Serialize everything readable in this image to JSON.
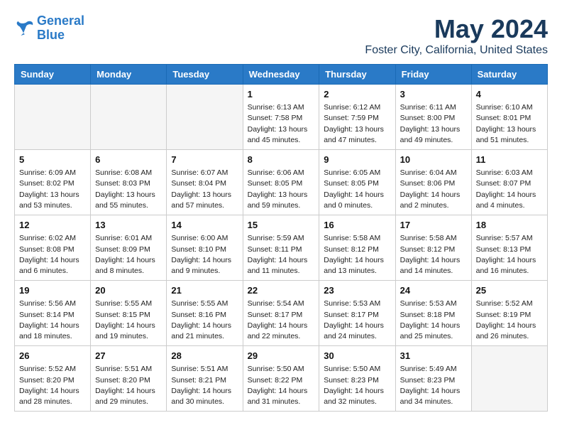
{
  "header": {
    "logo_line1": "General",
    "logo_line2": "Blue",
    "month": "May 2024",
    "location": "Foster City, California, United States"
  },
  "weekdays": [
    "Sunday",
    "Monday",
    "Tuesday",
    "Wednesday",
    "Thursday",
    "Friday",
    "Saturday"
  ],
  "weeks": [
    [
      {
        "day": "",
        "sunrise": "",
        "sunset": "",
        "daylight": ""
      },
      {
        "day": "",
        "sunrise": "",
        "sunset": "",
        "daylight": ""
      },
      {
        "day": "",
        "sunrise": "",
        "sunset": "",
        "daylight": ""
      },
      {
        "day": "1",
        "sunrise": "Sunrise: 6:13 AM",
        "sunset": "Sunset: 7:58 PM",
        "daylight": "Daylight: 13 hours and 45 minutes."
      },
      {
        "day": "2",
        "sunrise": "Sunrise: 6:12 AM",
        "sunset": "Sunset: 7:59 PM",
        "daylight": "Daylight: 13 hours and 47 minutes."
      },
      {
        "day": "3",
        "sunrise": "Sunrise: 6:11 AM",
        "sunset": "Sunset: 8:00 PM",
        "daylight": "Daylight: 13 hours and 49 minutes."
      },
      {
        "day": "4",
        "sunrise": "Sunrise: 6:10 AM",
        "sunset": "Sunset: 8:01 PM",
        "daylight": "Daylight: 13 hours and 51 minutes."
      }
    ],
    [
      {
        "day": "5",
        "sunrise": "Sunrise: 6:09 AM",
        "sunset": "Sunset: 8:02 PM",
        "daylight": "Daylight: 13 hours and 53 minutes."
      },
      {
        "day": "6",
        "sunrise": "Sunrise: 6:08 AM",
        "sunset": "Sunset: 8:03 PM",
        "daylight": "Daylight: 13 hours and 55 minutes."
      },
      {
        "day": "7",
        "sunrise": "Sunrise: 6:07 AM",
        "sunset": "Sunset: 8:04 PM",
        "daylight": "Daylight: 13 hours and 57 minutes."
      },
      {
        "day": "8",
        "sunrise": "Sunrise: 6:06 AM",
        "sunset": "Sunset: 8:05 PM",
        "daylight": "Daylight: 13 hours and 59 minutes."
      },
      {
        "day": "9",
        "sunrise": "Sunrise: 6:05 AM",
        "sunset": "Sunset: 8:05 PM",
        "daylight": "Daylight: 14 hours and 0 minutes."
      },
      {
        "day": "10",
        "sunrise": "Sunrise: 6:04 AM",
        "sunset": "Sunset: 8:06 PM",
        "daylight": "Daylight: 14 hours and 2 minutes."
      },
      {
        "day": "11",
        "sunrise": "Sunrise: 6:03 AM",
        "sunset": "Sunset: 8:07 PM",
        "daylight": "Daylight: 14 hours and 4 minutes."
      }
    ],
    [
      {
        "day": "12",
        "sunrise": "Sunrise: 6:02 AM",
        "sunset": "Sunset: 8:08 PM",
        "daylight": "Daylight: 14 hours and 6 minutes."
      },
      {
        "day": "13",
        "sunrise": "Sunrise: 6:01 AM",
        "sunset": "Sunset: 8:09 PM",
        "daylight": "Daylight: 14 hours and 8 minutes."
      },
      {
        "day": "14",
        "sunrise": "Sunrise: 6:00 AM",
        "sunset": "Sunset: 8:10 PM",
        "daylight": "Daylight: 14 hours and 9 minutes."
      },
      {
        "day": "15",
        "sunrise": "Sunrise: 5:59 AM",
        "sunset": "Sunset: 8:11 PM",
        "daylight": "Daylight: 14 hours and 11 minutes."
      },
      {
        "day": "16",
        "sunrise": "Sunrise: 5:58 AM",
        "sunset": "Sunset: 8:12 PM",
        "daylight": "Daylight: 14 hours and 13 minutes."
      },
      {
        "day": "17",
        "sunrise": "Sunrise: 5:58 AM",
        "sunset": "Sunset: 8:12 PM",
        "daylight": "Daylight: 14 hours and 14 minutes."
      },
      {
        "day": "18",
        "sunrise": "Sunrise: 5:57 AM",
        "sunset": "Sunset: 8:13 PM",
        "daylight": "Daylight: 14 hours and 16 minutes."
      }
    ],
    [
      {
        "day": "19",
        "sunrise": "Sunrise: 5:56 AM",
        "sunset": "Sunset: 8:14 PM",
        "daylight": "Daylight: 14 hours and 18 minutes."
      },
      {
        "day": "20",
        "sunrise": "Sunrise: 5:55 AM",
        "sunset": "Sunset: 8:15 PM",
        "daylight": "Daylight: 14 hours and 19 minutes."
      },
      {
        "day": "21",
        "sunrise": "Sunrise: 5:55 AM",
        "sunset": "Sunset: 8:16 PM",
        "daylight": "Daylight: 14 hours and 21 minutes."
      },
      {
        "day": "22",
        "sunrise": "Sunrise: 5:54 AM",
        "sunset": "Sunset: 8:17 PM",
        "daylight": "Daylight: 14 hours and 22 minutes."
      },
      {
        "day": "23",
        "sunrise": "Sunrise: 5:53 AM",
        "sunset": "Sunset: 8:17 PM",
        "daylight": "Daylight: 14 hours and 24 minutes."
      },
      {
        "day": "24",
        "sunrise": "Sunrise: 5:53 AM",
        "sunset": "Sunset: 8:18 PM",
        "daylight": "Daylight: 14 hours and 25 minutes."
      },
      {
        "day": "25",
        "sunrise": "Sunrise: 5:52 AM",
        "sunset": "Sunset: 8:19 PM",
        "daylight": "Daylight: 14 hours and 26 minutes."
      }
    ],
    [
      {
        "day": "26",
        "sunrise": "Sunrise: 5:52 AM",
        "sunset": "Sunset: 8:20 PM",
        "daylight": "Daylight: 14 hours and 28 minutes."
      },
      {
        "day": "27",
        "sunrise": "Sunrise: 5:51 AM",
        "sunset": "Sunset: 8:20 PM",
        "daylight": "Daylight: 14 hours and 29 minutes."
      },
      {
        "day": "28",
        "sunrise": "Sunrise: 5:51 AM",
        "sunset": "Sunset: 8:21 PM",
        "daylight": "Daylight: 14 hours and 30 minutes."
      },
      {
        "day": "29",
        "sunrise": "Sunrise: 5:50 AM",
        "sunset": "Sunset: 8:22 PM",
        "daylight": "Daylight: 14 hours and 31 minutes."
      },
      {
        "day": "30",
        "sunrise": "Sunrise: 5:50 AM",
        "sunset": "Sunset: 8:23 PM",
        "daylight": "Daylight: 14 hours and 32 minutes."
      },
      {
        "day": "31",
        "sunrise": "Sunrise: 5:49 AM",
        "sunset": "Sunset: 8:23 PM",
        "daylight": "Daylight: 14 hours and 34 minutes."
      },
      {
        "day": "",
        "sunrise": "",
        "sunset": "",
        "daylight": ""
      }
    ]
  ]
}
